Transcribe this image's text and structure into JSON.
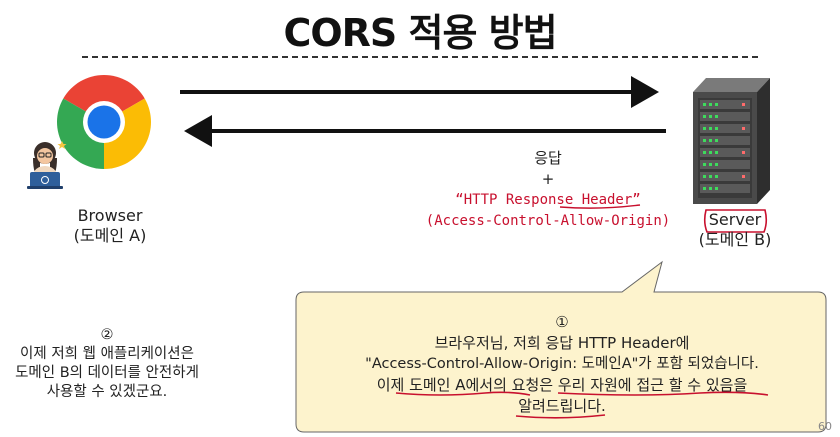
{
  "title": "CORS 적용 방법",
  "browser": {
    "name": "Browser",
    "domain": "(도메인 A)"
  },
  "server": {
    "name": "Server",
    "domain": "(도메인 B)"
  },
  "response": {
    "label": "응답",
    "plus": "+",
    "header": "“HTTP Response Header”",
    "detail": "(Access-Control-Allow-Origin)"
  },
  "note_left": {
    "number": "②",
    "lines": [
      "이제 저희 웹 애플리케이션은",
      "도메인 B의 데이터를 안전하게",
      "사용할 수 있겠군요."
    ]
  },
  "note_right": {
    "number": "①",
    "lines": [
      "브라우저님, 저희 응답  HTTP Header에",
      "\"Access-Control-Allow-Origin: 도메인A\"가 포함 되었습니다.",
      "이제 도메인 A에서의 요청은 우리 자원에 접근 할 수 있음을",
      "알려드립니다."
    ]
  },
  "colors": {
    "accent_red": "#c8102e",
    "bubble_fill": "#fdf3cd",
    "bubble_stroke": "#666666",
    "server_body": "#4a4a4a",
    "server_led": "#3ddc5c"
  },
  "icons": [
    "chrome-logo-icon",
    "developer-avatar-icon",
    "server-rack-icon",
    "arrow-right-icon",
    "arrow-left-icon"
  ],
  "page_number": "60"
}
